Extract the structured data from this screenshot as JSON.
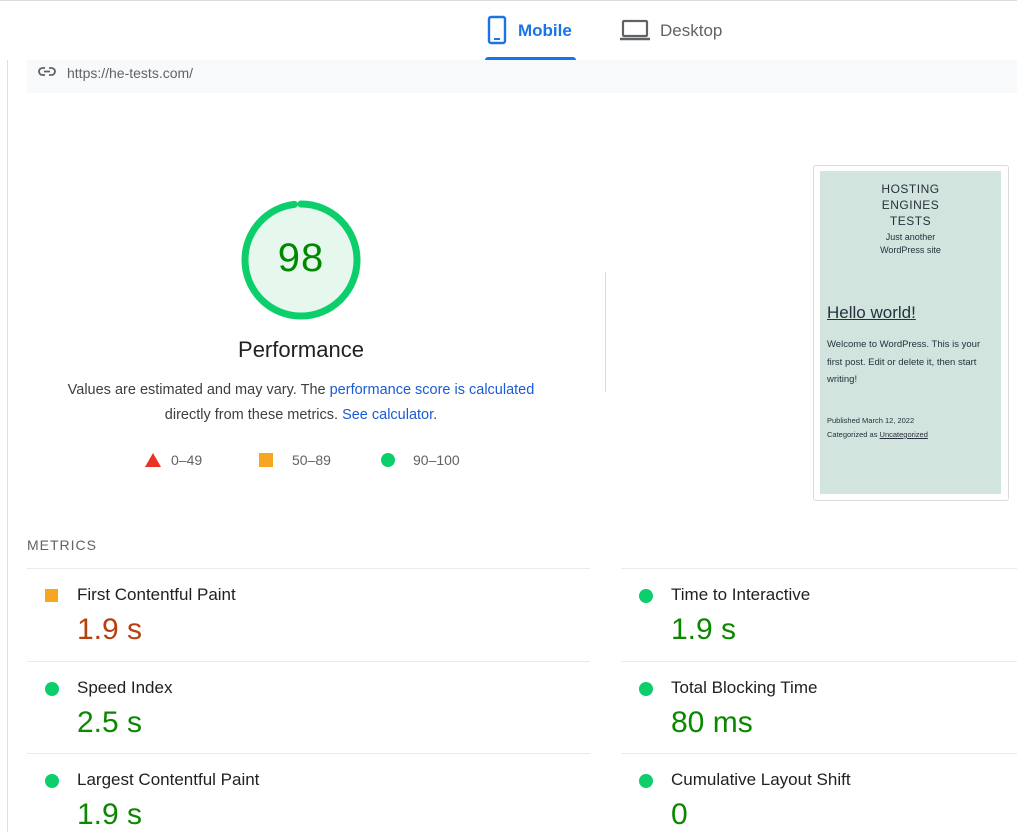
{
  "tabs": [
    {
      "label": "Mobile",
      "icon": "mobile-phone-icon",
      "active": true
    },
    {
      "label": "Desktop",
      "icon": "laptop-icon",
      "active": false
    }
  ],
  "url_bar": {
    "icon": "link-icon",
    "url": "https://he-tests.com/"
  },
  "performance": {
    "score": "98",
    "score_fraction": 0.98,
    "title": "Performance",
    "desc_prefix": "Values are estimated and may vary. The ",
    "desc_link1": "performance score is calculated",
    "desc_middle": " directly from these metrics. ",
    "desc_link2": "See calculator",
    "desc_suffix": "."
  },
  "legend": [
    {
      "range": "0–49",
      "shape": "triangle",
      "color": "#eb3323"
    },
    {
      "range": "50–89",
      "shape": "square",
      "color": "#f6a623"
    },
    {
      "range": "90–100",
      "shape": "circle",
      "color": "#0cce6b"
    }
  ],
  "thumbnail": {
    "site_title_1": "HOSTING",
    "site_title_2": "ENGINES",
    "site_title_3": "TESTS",
    "tagline_1": "Just another",
    "tagline_2": "WordPress site",
    "post_title": "Hello world!",
    "post_body": "Welcome to WordPress. This is your first post. Edit or delete it, then start writing!",
    "published": "Published March 12, 2022",
    "categorized_prefix": "Categorized as ",
    "category": "Uncategorized",
    "background": "#d1e4dd"
  },
  "metrics": {
    "heading": "METRICS",
    "items": [
      {
        "name": "First Contentful Paint",
        "value": "1.9 s",
        "status": "average"
      },
      {
        "name": "Time to Interactive",
        "value": "1.9 s",
        "status": "good"
      },
      {
        "name": "Speed Index",
        "value": "2.5 s",
        "status": "good"
      },
      {
        "name": "Total Blocking Time",
        "value": "80 ms",
        "status": "good"
      },
      {
        "name": "Largest Contentful Paint",
        "value": "1.9 s",
        "status": "good"
      },
      {
        "name": "Cumulative Layout Shift",
        "value": "0",
        "status": "good"
      }
    ]
  },
  "colors": {
    "accent": "#1a73e8",
    "good": "#0cce6b",
    "good_text": "#0b8700",
    "average": "#f6a623",
    "average_text": "#b7400e",
    "poor": "#eb3323"
  }
}
